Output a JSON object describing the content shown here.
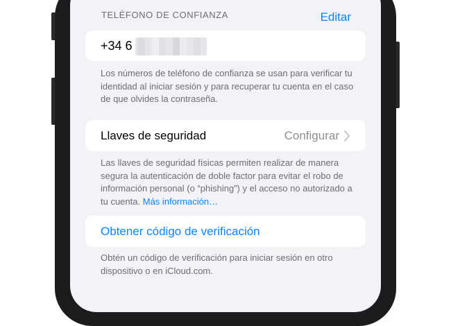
{
  "trusted_phone": {
    "header": "TELÉFONO DE CONFIANZA",
    "edit_label": "Editar",
    "number_prefix": "+34 6",
    "footnote": "Los números de teléfono de confianza se usan para verificar tu identidad al iniciar sesión y para recuperar tu cuenta en el caso de que olvides la contraseña."
  },
  "security_keys": {
    "label": "Llaves de seguridad",
    "value": "Configurar",
    "chevron_icon": "chevron-right-icon",
    "footnote": "Las llaves de seguridad físicas permiten realizar de manera segura la autenticación de doble factor para evitar el robo de información personal (o “phishing”) y el acceso no autorizado a tu cuenta.",
    "more_link": "Más información…"
  },
  "verification_code": {
    "action_label": "Obtener código de verificación",
    "footnote": "Obtén un código de verificación para iniciar sesión en otro dispositivo o en iCloud.com."
  },
  "colors": {
    "accent": "#0a84ff",
    "background": "#f2f2f7",
    "card": "#ffffff",
    "secondary_text": "#6d6d72"
  }
}
